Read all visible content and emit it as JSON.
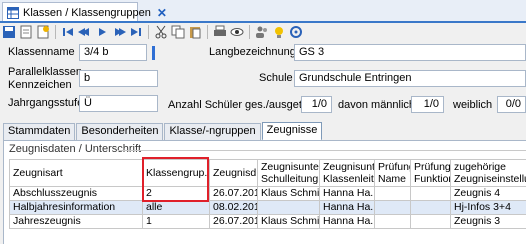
{
  "window": {
    "tab_title": "Klassen / Klassengruppen",
    "close_glyph": "✕"
  },
  "toolbar": {
    "icons": [
      "save-icon",
      "document-icon",
      "new-icon",
      "first-icon",
      "prev-icon",
      "play-icon",
      "next-icon",
      "last-icon",
      "cut-icon",
      "copy-icon",
      "paste-icon",
      "print-icon",
      "preview-icon",
      "users-icon",
      "lamp-icon",
      "settings-icon"
    ]
  },
  "form": {
    "klassenname_label": "Klassenname",
    "klassenname_value": "3/4 b",
    "parallelklassen_label_1": "Parallelklassen",
    "parallelklassen_label_2": "Kennzeichen",
    "parallelklassen_value": "b",
    "jahrgangsstufe_label": "Jahrgangsstufe",
    "jahrgangsstufe_value": "Ü",
    "langbezeichnung_label": "Langbezeichnung",
    "langbezeichnung_value": "GS 3",
    "schule_label": "Schule",
    "schule_value": "Grundschule Entringen",
    "anzahl_label": "Anzahl Schüler ges./ausgetr.",
    "anzahl_value": "1/0",
    "maennlich_label": "davon männlich",
    "maennlich_value": "1/0",
    "weiblich_label": "weiblich",
    "weiblich_value": "0/0"
  },
  "tabs": [
    "Stammdaten",
    "Besonderheiten",
    "Klasse/-ngruppen",
    "Zeugnisse"
  ],
  "active_tab": "Zeugnisse",
  "section": {
    "title": "Zeugnisdaten / Unterschrift"
  },
  "table": {
    "columns": [
      [
        "Zeugnisart",
        ""
      ],
      [
        "Klassengrup...",
        ""
      ],
      [
        "Zeugnisd...",
        ""
      ],
      [
        "Zeugnisunter",
        "Schulleitung"
      ],
      [
        "Zeugnisunte",
        "Klassenleitun"
      ],
      [
        "Prüfung",
        "Name"
      ],
      [
        "Prüfungs",
        "Funktion"
      ],
      [
        "zugehörige",
        "Zeugniseinstellung"
      ]
    ],
    "rows": [
      [
        "Abschlusszeugnis",
        "2",
        "26.07.2019",
        "Klaus Schmi...",
        "Hanna Ha...",
        "",
        "",
        "Zeugnis 4"
      ],
      [
        "Halbjahresinformation",
        "alle",
        "08.02.2019",
        "",
        "Hanna Ha...",
        "",
        "",
        "Hj-Infos 3+4"
      ],
      [
        "Jahreszeugnis",
        "1",
        "26.07.2019",
        "Klaus Schmi...",
        "Hanna Ha...",
        "",
        "",
        "Zeugnis 3"
      ]
    ]
  },
  "colors": {
    "accent": "#3a78c9",
    "highlight": "#e0202a"
  }
}
